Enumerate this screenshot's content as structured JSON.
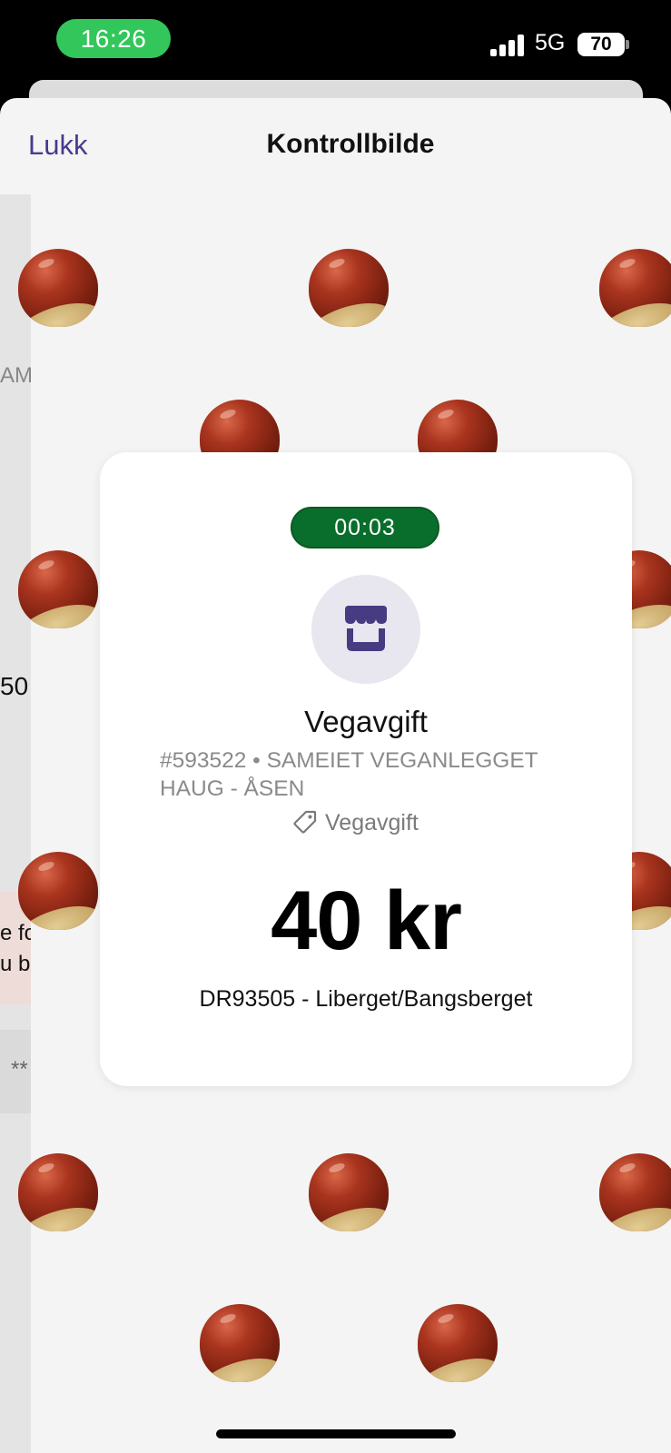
{
  "status_bar": {
    "time": "16:26",
    "network": "5G",
    "battery": "70",
    "battery_level_percent": 70
  },
  "header": {
    "close_label": "Lukk",
    "title": "Kontrollbilde"
  },
  "background": {
    "pattern_icon": "chestnut-icon",
    "partial_texts": [
      "AM",
      "50",
      "e fo",
      "u bi",
      "**"
    ]
  },
  "receipt": {
    "timer": "00:03",
    "icon": "shop-icon",
    "merchant": "Vegavgift",
    "reference": "#593522 • SAMEIET VEGANLEGGET HAUG - ÅSEN",
    "category_icon": "tag-icon",
    "category": "Vegavgift",
    "amount": "40 kr",
    "description": "DR93505 - Liberget/Bangsberget"
  },
  "colors": {
    "accent": "#4a3a8c",
    "timer_bg": "#096e2b",
    "status_time_bg": "#33c65a"
  }
}
